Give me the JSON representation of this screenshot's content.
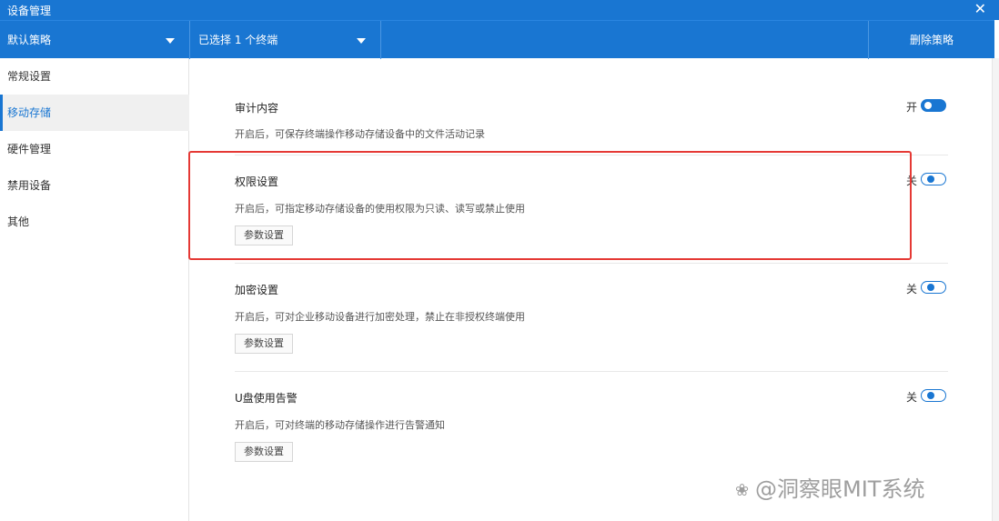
{
  "window": {
    "title": "设备管理",
    "close_glyph": "✕"
  },
  "toolbar": {
    "policy_select": "默认策略",
    "terminal_select": "已选择 1 个终端",
    "delete_button": "删除策略"
  },
  "sidebar": {
    "items": [
      {
        "label": "常规设置",
        "active": false
      },
      {
        "label": "移动存储",
        "active": true
      },
      {
        "label": "硬件管理",
        "active": false
      },
      {
        "label": "禁用设备",
        "active": false
      },
      {
        "label": "其他",
        "active": false
      }
    ]
  },
  "sections": [
    {
      "title": "审计内容",
      "desc": "开启后，可保存终端操作移动存储设备中的文件活动记录",
      "state_label": "开",
      "enabled": true,
      "param_button": ""
    },
    {
      "title": "权限设置",
      "desc": "开启后，可指定移动存储设备的使用权限为只读、读写或禁止使用",
      "state_label": "关",
      "enabled": false,
      "param_button": "参数设置"
    },
    {
      "title": "加密设置",
      "desc": "开启后，可对企业移动设备进行加密处理，禁止在非授权终端使用",
      "state_label": "关",
      "enabled": false,
      "param_button": "参数设置"
    },
    {
      "title": "U盘使用告警",
      "desc": "开启后，可对终端的移动存储操作进行告警通知",
      "state_label": "关",
      "enabled": false,
      "param_button": "参数设置"
    }
  ],
  "colors": {
    "accent": "#1976d2",
    "highlight": "#e53935"
  },
  "icons": {
    "close": "close-icon",
    "caret": "chevron-down-icon"
  },
  "watermark": {
    "text": "@洞察眼MIT系统"
  }
}
